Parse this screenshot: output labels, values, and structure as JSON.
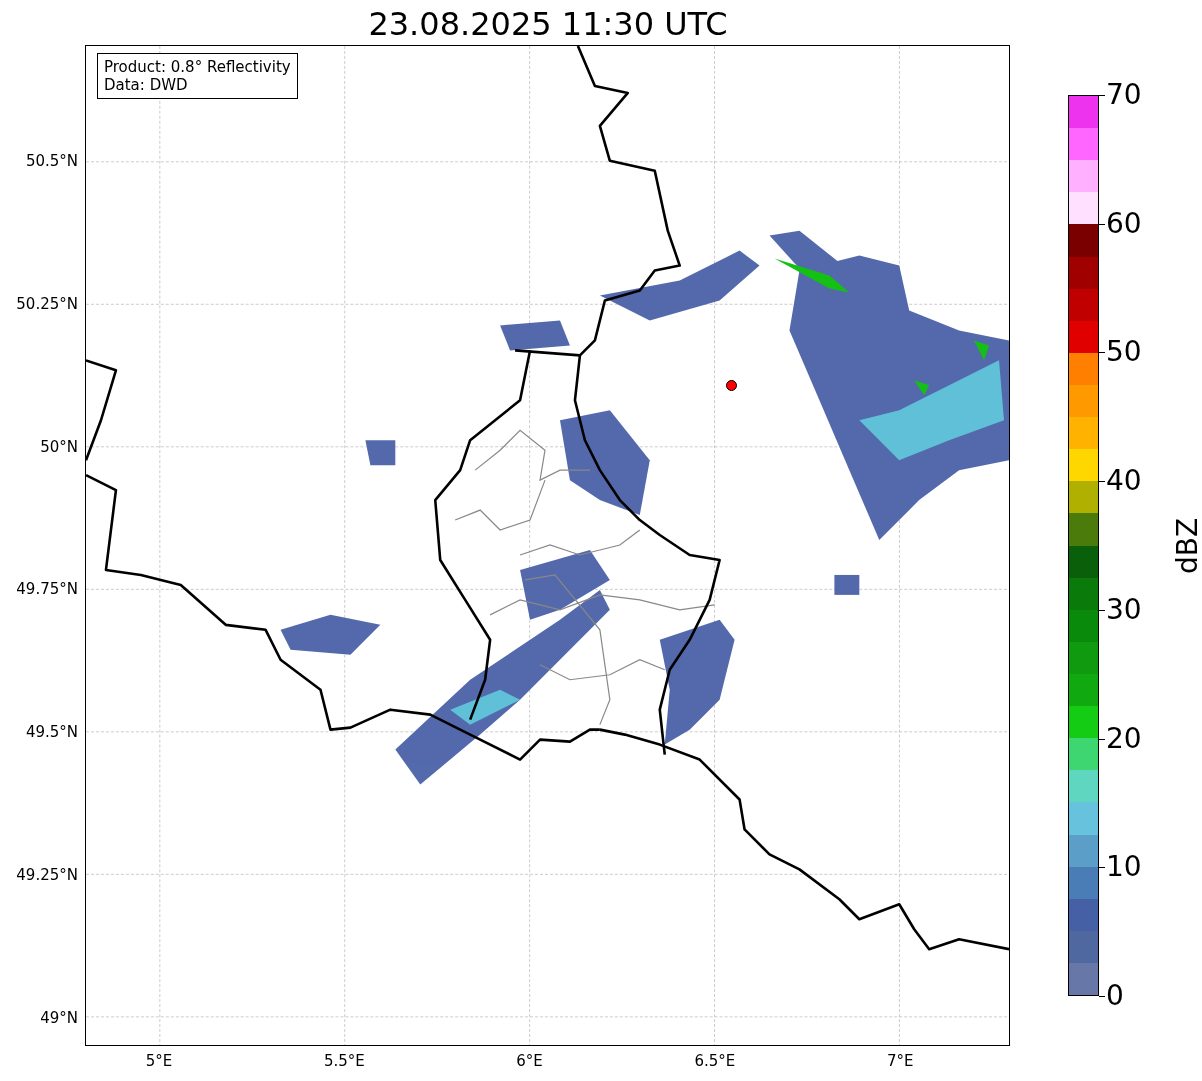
{
  "title": "23.08.2025 11:30 UTC",
  "legend": [
    "Product: 0.8° Reflectivity",
    "Data: DWD"
  ],
  "map": {
    "lat_ticks": [
      "50.5°N",
      "50.25°N",
      "50°N",
      "49.75°N",
      "49.5°N",
      "49.25°N",
      "49°N"
    ],
    "lon_ticks": [
      "5°E",
      "5.5°E",
      "6°E",
      "6.5°E",
      "7°E"
    ]
  },
  "colorbar": {
    "label": "dBZ",
    "ticks": [
      "70",
      "60",
      "50",
      "40",
      "30",
      "20",
      "10",
      "0"
    ],
    "segments": [
      {
        "color": "#ee33ee"
      },
      {
        "color": "#ff66ff"
      },
      {
        "color": "#ffb0ff"
      },
      {
        "color": "#ffe0ff"
      },
      {
        "color": "#7a0000"
      },
      {
        "color": "#a00000"
      },
      {
        "color": "#c00000"
      },
      {
        "color": "#e00000"
      },
      {
        "color": "#ff7f00"
      },
      {
        "color": "#ff9900"
      },
      {
        "color": "#ffb300"
      },
      {
        "color": "#ffd700"
      },
      {
        "color": "#b0b000"
      },
      {
        "color": "#4b7b0a"
      },
      {
        "color": "#0a5f0a"
      },
      {
        "color": "#0a7a0a"
      },
      {
        "color": "#0a8a0a"
      },
      {
        "color": "#0f9a0f"
      },
      {
        "color": "#10aa10"
      },
      {
        "color": "#14cc14"
      },
      {
        "color": "#3dd670"
      },
      {
        "color": "#5fd7c0"
      },
      {
        "color": "#66c2dd"
      },
      {
        "color": "#5b9ec8"
      },
      {
        "color": "#4a7db5"
      },
      {
        "color": "#4560a5"
      },
      {
        "color": "#5068a0"
      },
      {
        "color": "#6777a8"
      }
    ]
  }
}
